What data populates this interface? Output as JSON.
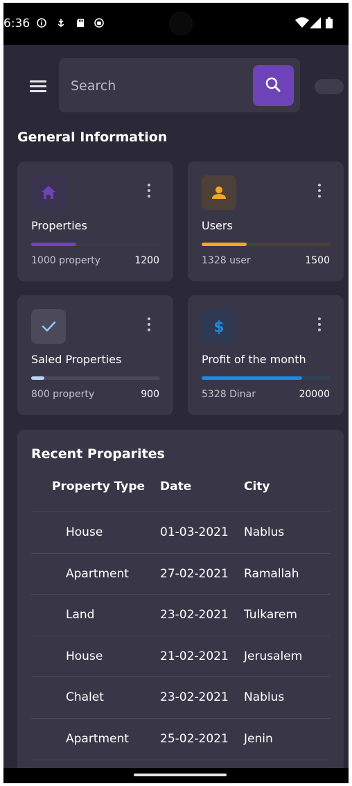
{
  "status_bar": {
    "time": "6:36",
    "icons": [
      "info-icon",
      "usb-debug-icon",
      "sd-card-icon",
      "app-notification-icon",
      "wifi-icon",
      "signal-icon",
      "battery-icon"
    ]
  },
  "header": {
    "menu_icon": "menu-icon",
    "search": {
      "placeholder": "Search",
      "value": "",
      "button_icon": "search-icon",
      "button_color": "#6e43b8"
    },
    "toggle_state": "off"
  },
  "general": {
    "title": "General Information",
    "cards": [
      {
        "title": "Properties",
        "subtitle": "1000 property",
        "total": "1200",
        "icon": "home-icon",
        "accent": "#6e43b8",
        "icon_bg": "#3a3350",
        "track": "#3d3b4a",
        "progress": 0.35
      },
      {
        "title": "Users",
        "subtitle": "1328 user",
        "total": "1500",
        "icon": "person-icon",
        "accent": "#f5a623",
        "icon_bg": "#4d4038",
        "track": "#4a3f3b",
        "progress": 0.35
      },
      {
        "title": "Saled Properties",
        "subtitle": "800 property",
        "total": "900",
        "icon": "check-icon",
        "accent": "#b8d4f0",
        "icon_bg": "#4c4a5a",
        "track": "#494756",
        "progress": 0.1
      },
      {
        "title": "Profit of the month",
        "subtitle": "5328 Dinar",
        "total": "20000",
        "icon": "dollar-icon",
        "accent": "#1e88e5",
        "icon_bg": "#2f3a52",
        "track": "#33405a",
        "progress": 0.78
      }
    ]
  },
  "recent": {
    "title": "Recent Proparites",
    "columns": [
      "Property Type",
      "Date",
      "City"
    ],
    "rows": [
      [
        "House",
        "01-03-2021",
        "Nablus"
      ],
      [
        "Apartment",
        "27-02-2021",
        "Ramallah"
      ],
      [
        "Land",
        "23-02-2021",
        "Tulkarem"
      ],
      [
        "House",
        "21-02-2021",
        "Jerusalem"
      ],
      [
        "Chalet",
        "23-02-2021",
        "Nablus"
      ],
      [
        "Apartment",
        "25-02-2021",
        "Jenin"
      ]
    ]
  }
}
